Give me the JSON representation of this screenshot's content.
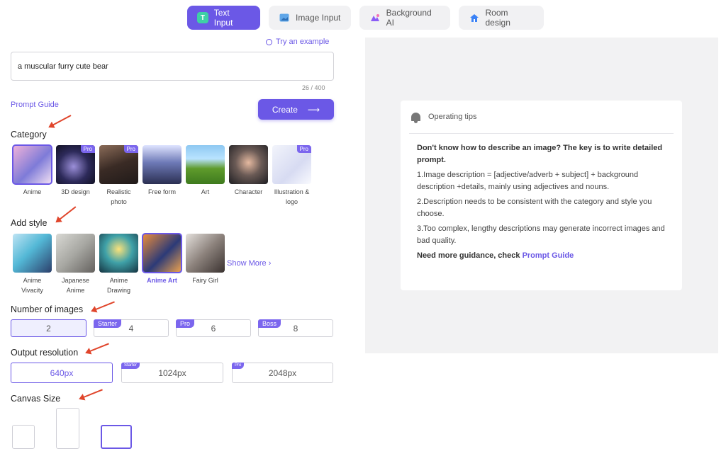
{
  "tabs": [
    {
      "label": "Text Input",
      "icon": "text-icon",
      "active": true
    },
    {
      "label": "Image Input",
      "icon": "image-icon",
      "active": false
    },
    {
      "label": "Background AI",
      "icon": "background-icon",
      "active": false
    },
    {
      "label": "Room design",
      "icon": "home-icon",
      "active": false
    }
  ],
  "prompt": {
    "try_example": "Try an example",
    "value": "a muscular furry cute bear",
    "counter": "26 / 400",
    "guide_link": "Prompt Guide",
    "create_label": "Create",
    "create_arrow": "⟶"
  },
  "category": {
    "title": "Category",
    "items": [
      {
        "label": "Anime",
        "pro": false,
        "selected": true
      },
      {
        "label": "3D design",
        "pro": true
      },
      {
        "label": "Realistic photo",
        "pro": true
      },
      {
        "label": "Free form",
        "pro": false
      },
      {
        "label": "Art",
        "pro": false
      },
      {
        "label": "Character",
        "pro": false
      },
      {
        "label": "Illustration & logo",
        "pro": true
      }
    ],
    "pro_label": "Pro"
  },
  "style": {
    "title": "Add style",
    "items": [
      {
        "label": "Anime Vivacity"
      },
      {
        "label": "Japanese Anime"
      },
      {
        "label": "Anime Drawing"
      },
      {
        "label": "Anime Art",
        "selected": true
      },
      {
        "label": "Fairy Girl"
      }
    ],
    "show_more": "Show More ›"
  },
  "num_images": {
    "title": "Number of images",
    "options": [
      {
        "value": "2",
        "tag": "",
        "selected": true
      },
      {
        "value": "4",
        "tag": "Starter"
      },
      {
        "value": "6",
        "tag": "Pro"
      },
      {
        "value": "8",
        "tag": "Boss"
      }
    ]
  },
  "resolution": {
    "title": "Output resolution",
    "options": [
      {
        "value": "640px",
        "tag": "",
        "selected": true
      },
      {
        "value": "1024px",
        "tag": "Starter"
      },
      {
        "value": "2048px",
        "tag": "Pro"
      }
    ]
  },
  "canvas": {
    "title": "Canvas Size"
  },
  "tips": {
    "title": "Operating tips",
    "intro": "Don't know how to describe an image? The key is to write detailed prompt.",
    "tip1": "1.Image description = [adjective/adverb + subject] + background description +details, mainly using adjectives and nouns.",
    "tip2": "2.Description needs to be consistent with the category and style you choose.",
    "tip3": "3.Too complex, lengthy descriptions may generate incorrect images and bad quality.",
    "guidance": "Need more guidance, check ",
    "guidance_link": "Prompt Guide"
  },
  "colors": {
    "accent": "#6b58e6",
    "annotation_arrow": "#e0452b"
  }
}
